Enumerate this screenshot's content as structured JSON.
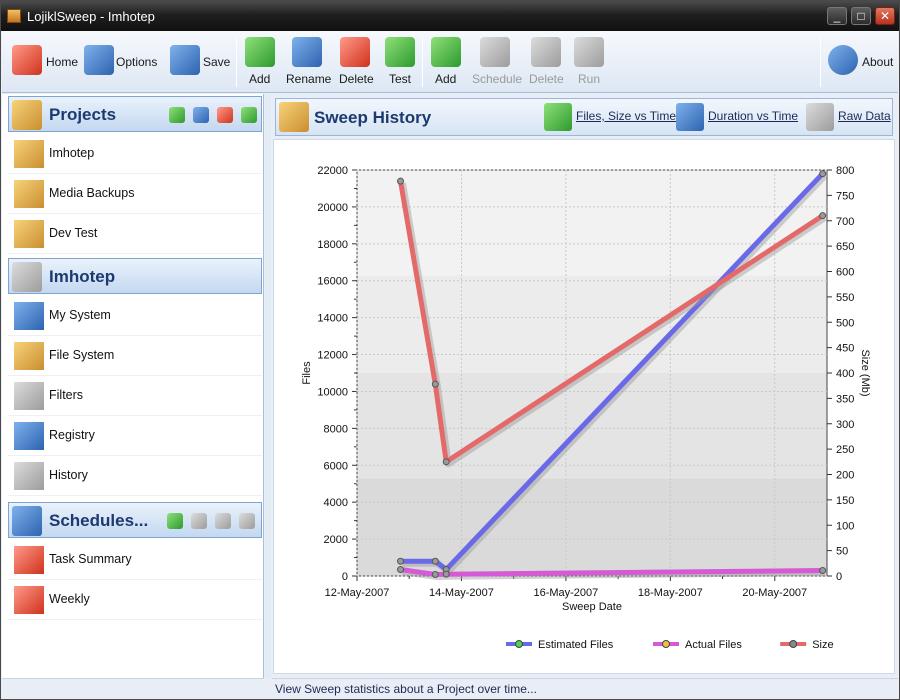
{
  "window": {
    "title": "LojiklSweep - Imhotep"
  },
  "toolbar": {
    "home": "Home",
    "options": "Options",
    "save": "Save",
    "project": [
      {
        "label": "Add"
      },
      {
        "label": "Rename"
      },
      {
        "label": "Delete"
      },
      {
        "label": "Test"
      }
    ],
    "schedule": [
      {
        "label": "Add",
        "enabled": true
      },
      {
        "label": "Schedule",
        "enabled": false
      },
      {
        "label": "Delete",
        "enabled": false
      },
      {
        "label": "Run",
        "enabled": false
      }
    ],
    "about": "About"
  },
  "sidebar": {
    "projects_title": "Projects",
    "projects": [
      {
        "label": "Imhotep"
      },
      {
        "label": "Media Backups"
      },
      {
        "label": "Dev Test"
      }
    ],
    "project_title": "Imhotep",
    "project_items": [
      {
        "label": "My System"
      },
      {
        "label": "File System"
      },
      {
        "label": "Filters"
      },
      {
        "label": "Registry"
      },
      {
        "label": "History"
      }
    ],
    "schedules_title": "Schedules...",
    "schedule_items": [
      {
        "label": "Task Summary"
      },
      {
        "label": "Weekly"
      }
    ]
  },
  "main": {
    "title": "Sweep History",
    "views": [
      {
        "label": "Files, Size vs Time"
      },
      {
        "label": "Duration vs Time"
      },
      {
        "label": "Raw Data"
      }
    ]
  },
  "status": {
    "text": "View Sweep statistics about a Project over time..."
  },
  "chart_data": {
    "type": "line",
    "xlabel": "Sweep Date",
    "ylabel": "Files",
    "y2label": "Size (Mb)",
    "ylim": [
      0,
      22000
    ],
    "y2lim": [
      0,
      800
    ],
    "xlim": [
      "2007-05-12",
      "2007-05-21"
    ],
    "xticks": [
      "12-May-2007",
      "14-May-2007",
      "16-May-2007",
      "18-May-2007",
      "20-May-2007"
    ],
    "yticks": [
      0,
      2000,
      4000,
      6000,
      8000,
      10000,
      12000,
      14000,
      16000,
      18000,
      20000,
      22000
    ],
    "y2ticks": [
      0,
      50,
      100,
      150,
      200,
      250,
      300,
      350,
      400,
      450,
      500,
      550,
      600,
      650,
      700,
      750,
      800
    ],
    "grid": true,
    "legend_position": "bottom",
    "colors": {
      "Estimated Files": "#6a6ae8",
      "Actual Files": "#d65ad6",
      "Size": "#e46a6a"
    },
    "series": [
      {
        "name": "Estimated Files",
        "axis": "left",
        "points": [
          [
            "2007-05-12 20:00",
            800
          ],
          [
            "2007-05-13 12:00",
            800
          ],
          [
            "2007-05-13 17:00",
            350
          ],
          [
            "2007-05-20 22:00",
            21800
          ]
        ]
      },
      {
        "name": "Actual Files",
        "axis": "left",
        "points": [
          [
            "2007-05-12 20:00",
            350
          ],
          [
            "2007-05-13 12:00",
            80
          ],
          [
            "2007-05-13 17:00",
            100
          ],
          [
            "2007-05-20 22:00",
            300
          ]
        ]
      },
      {
        "name": "Size",
        "axis": "right",
        "points": [
          [
            "2007-05-12 20:00",
            778
          ],
          [
            "2007-05-13 12:00",
            378
          ],
          [
            "2007-05-13 17:00",
            225
          ],
          [
            "2007-05-20 22:00",
            710
          ]
        ]
      }
    ]
  }
}
